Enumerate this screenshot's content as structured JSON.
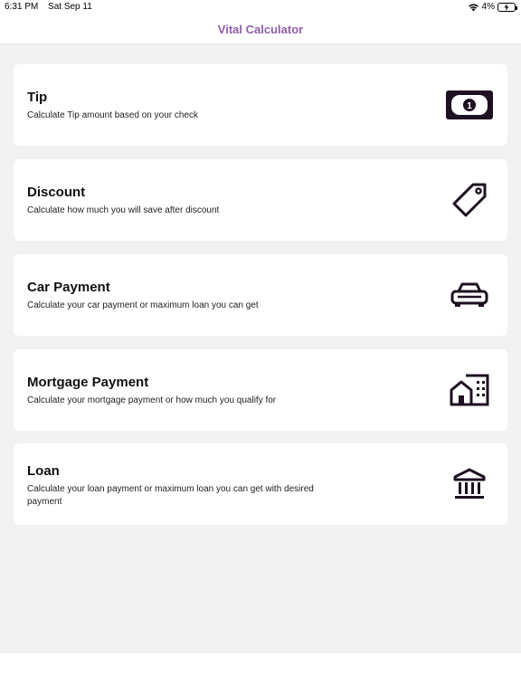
{
  "status_bar": {
    "time": "6:31 PM",
    "date": "Sat Sep 11",
    "battery": "4%"
  },
  "nav": {
    "title": "Vital Calculator",
    "title_color": "#8f5fa8"
  },
  "cards": [
    {
      "title": "Tip",
      "description": "Calculate Tip amount based on your check",
      "icon": "banknote-icon"
    },
    {
      "title": "Discount",
      "description": "Calculate how much you will save after discount",
      "icon": "price-tag-icon"
    },
    {
      "title": "Car Payment",
      "description": "Calculate your car payment or maximum loan you can get",
      "icon": "car-icon"
    },
    {
      "title": "Mortgage Payment",
      "description": "Calculate your mortgage payment or how much you qualify for",
      "icon": "house-building-icon"
    },
    {
      "title": "Loan",
      "description": "Calculate your loan payment or maximum loan you can get with desired payment",
      "icon": "bank-icon"
    }
  ]
}
